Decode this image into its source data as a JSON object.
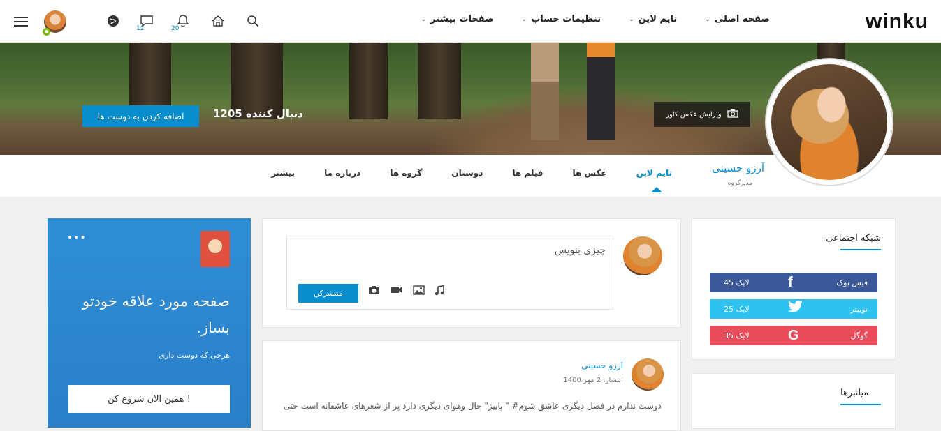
{
  "brand": {
    "logo_text": "winku",
    "accent": "#088dcd"
  },
  "topnav": {
    "menu": [
      "صفحه اصلی",
      "تایم لاین",
      "تنظیمات حساب",
      "صفحات بیشتر"
    ],
    "messages_count": "12",
    "notifications_count": "20"
  },
  "cover": {
    "add_friend_label": "اضافه کردن به دوست ها",
    "followers": "1205 دنبال کننده",
    "edit_cover_label": "ویرایش عکس کاور"
  },
  "profile": {
    "name": "آرزو حسینی",
    "role": "مدیرگروه"
  },
  "tabs": [
    "تایم لاین",
    "عکس ها",
    "فیلم ها",
    "دوستان",
    "گروه ها",
    "درباره ما",
    "بیشتر"
  ],
  "social_widget": {
    "title": "شبکه اجتماعی",
    "items": [
      {
        "name": "فیس بوک",
        "likes": "45 لایک",
        "icon": "f",
        "color": "#3b5998"
      },
      {
        "name": "توییتر",
        "likes": "25 لایک",
        "icon": "t",
        "color": "#1da1f2"
      },
      {
        "name": "گوگل",
        "likes": "35 لایک",
        "icon": "G",
        "color": "#ea4c5c"
      }
    ]
  },
  "shortcuts_widget": {
    "title": "میانبرها"
  },
  "composer": {
    "placeholder": "چیزی بنویس",
    "publish_label": "منتشرکن"
  },
  "post": {
    "author": "آرزو حسینی",
    "date": "انتشار: 2 مهر 1400",
    "text": "دوست ندارم در فصل دیگری عاشق شوم# \" پاییز\" حال وهوای دیگری دارد پر از شعرهای عاشقانه است حتی"
  },
  "promo": {
    "title": "صفحه مورد علاقه خودتو بساز.",
    "subtitle": "هرچی که دوست داری",
    "button": "همین الان شروع کن !"
  }
}
